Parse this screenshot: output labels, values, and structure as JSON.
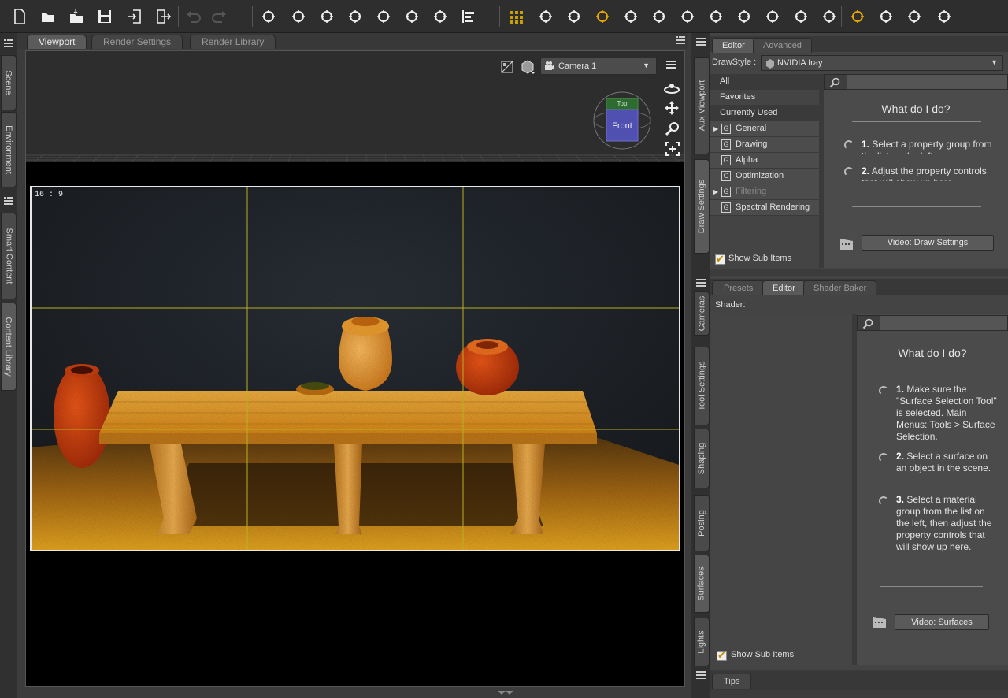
{
  "toolbar": {
    "icons": [
      "new-file-icon",
      "open-file-icon",
      "merge-file-icon",
      "save-icon",
      "import-icon",
      "export-icon",
      "undo-icon",
      "redo-icon",
      "camera-plus-icon",
      "spotlight-icon",
      "point-light-icon",
      "distant-light-icon",
      "linear-light-icon",
      "primitive-icon",
      "node-select-icon",
      "align-icon",
      "iray-render-icon",
      "universal-tool-icon",
      "select-tool-icon",
      "surface-select-icon",
      "rotate-tool-icon",
      "translate-tool-icon",
      "scale-tool-icon",
      "joint-editor-icon",
      "morph-tool-icon",
      "geometry-editor-icon",
      "figure-tool-icon",
      "render-camera-icon",
      "render-settings-icon",
      "spot-render-icon",
      "render-icon",
      "camera-snapshot-icon"
    ]
  },
  "left_rail": {
    "tabs": [
      "Scene",
      "Environment",
      "Smart Content",
      "Content Library"
    ]
  },
  "viewport_panel": {
    "tabs": [
      "Viewport",
      "Render Settings",
      "Render Library"
    ],
    "active_tab": "Viewport",
    "camera": "Camera 1",
    "aspect": "16 : 9",
    "navcube_face": "Front",
    "navcube_top": "Top"
  },
  "mid_rail": {
    "top_tabs": [
      "Aux Viewport",
      "Draw Settings"
    ],
    "bottom_tabs": [
      "Cameras",
      "Tool Settings",
      "Shaping",
      "Posing",
      "Surfaces",
      "Lights"
    ]
  },
  "draw_settings": {
    "tabs": [
      "Editor",
      "Advanced"
    ],
    "drawstyle_label": "DrawStyle :",
    "drawstyle_value": "NVIDIA Iray",
    "filters": [
      "All",
      "Favorites",
      "Currently Used"
    ],
    "groups": [
      {
        "name": "General",
        "expandable": true,
        "enabled": true
      },
      {
        "name": "Drawing",
        "expandable": false,
        "enabled": true
      },
      {
        "name": "Alpha",
        "expandable": false,
        "enabled": true
      },
      {
        "name": "Optimization",
        "expandable": false,
        "enabled": true
      },
      {
        "name": "Filtering",
        "expandable": true,
        "enabled": false
      },
      {
        "name": "Spectral Rendering",
        "expandable": false,
        "enabled": true
      }
    ],
    "group_icon_letter": "G",
    "help_title": "What do I do?",
    "steps": [
      {
        "num": "1.",
        "text": "Select a property group from the list on the left."
      },
      {
        "num": "2.",
        "text": "Adjust the property controls that will show up here."
      }
    ],
    "video_button": "Video: Draw Settings",
    "show_sub_items": "Show Sub Items"
  },
  "surfaces": {
    "tabs": [
      "Presets",
      "Editor",
      "Shader Baker"
    ],
    "shader_label": "Shader:",
    "help_title": "What do I do?",
    "steps": [
      {
        "num": "1.",
        "text": "Make sure the \"Surface Selection Tool\" is selected. Main Menus: Tools > Surface Selection."
      },
      {
        "num": "2.",
        "text": "Select a surface on an object in the scene."
      },
      {
        "num": "3.",
        "text": "Select a material group from the list on the left, then adjust the property controls that will show up here."
      }
    ],
    "video_button": "Video: Surfaces",
    "show_sub_items": "Show Sub Items"
  },
  "tips_tab": "Tips",
  "colors": {
    "accent": "#e8a800",
    "render_gold": "#e89a10",
    "render_red": "#c83c10",
    "grid_yellow": "#b8b020"
  }
}
